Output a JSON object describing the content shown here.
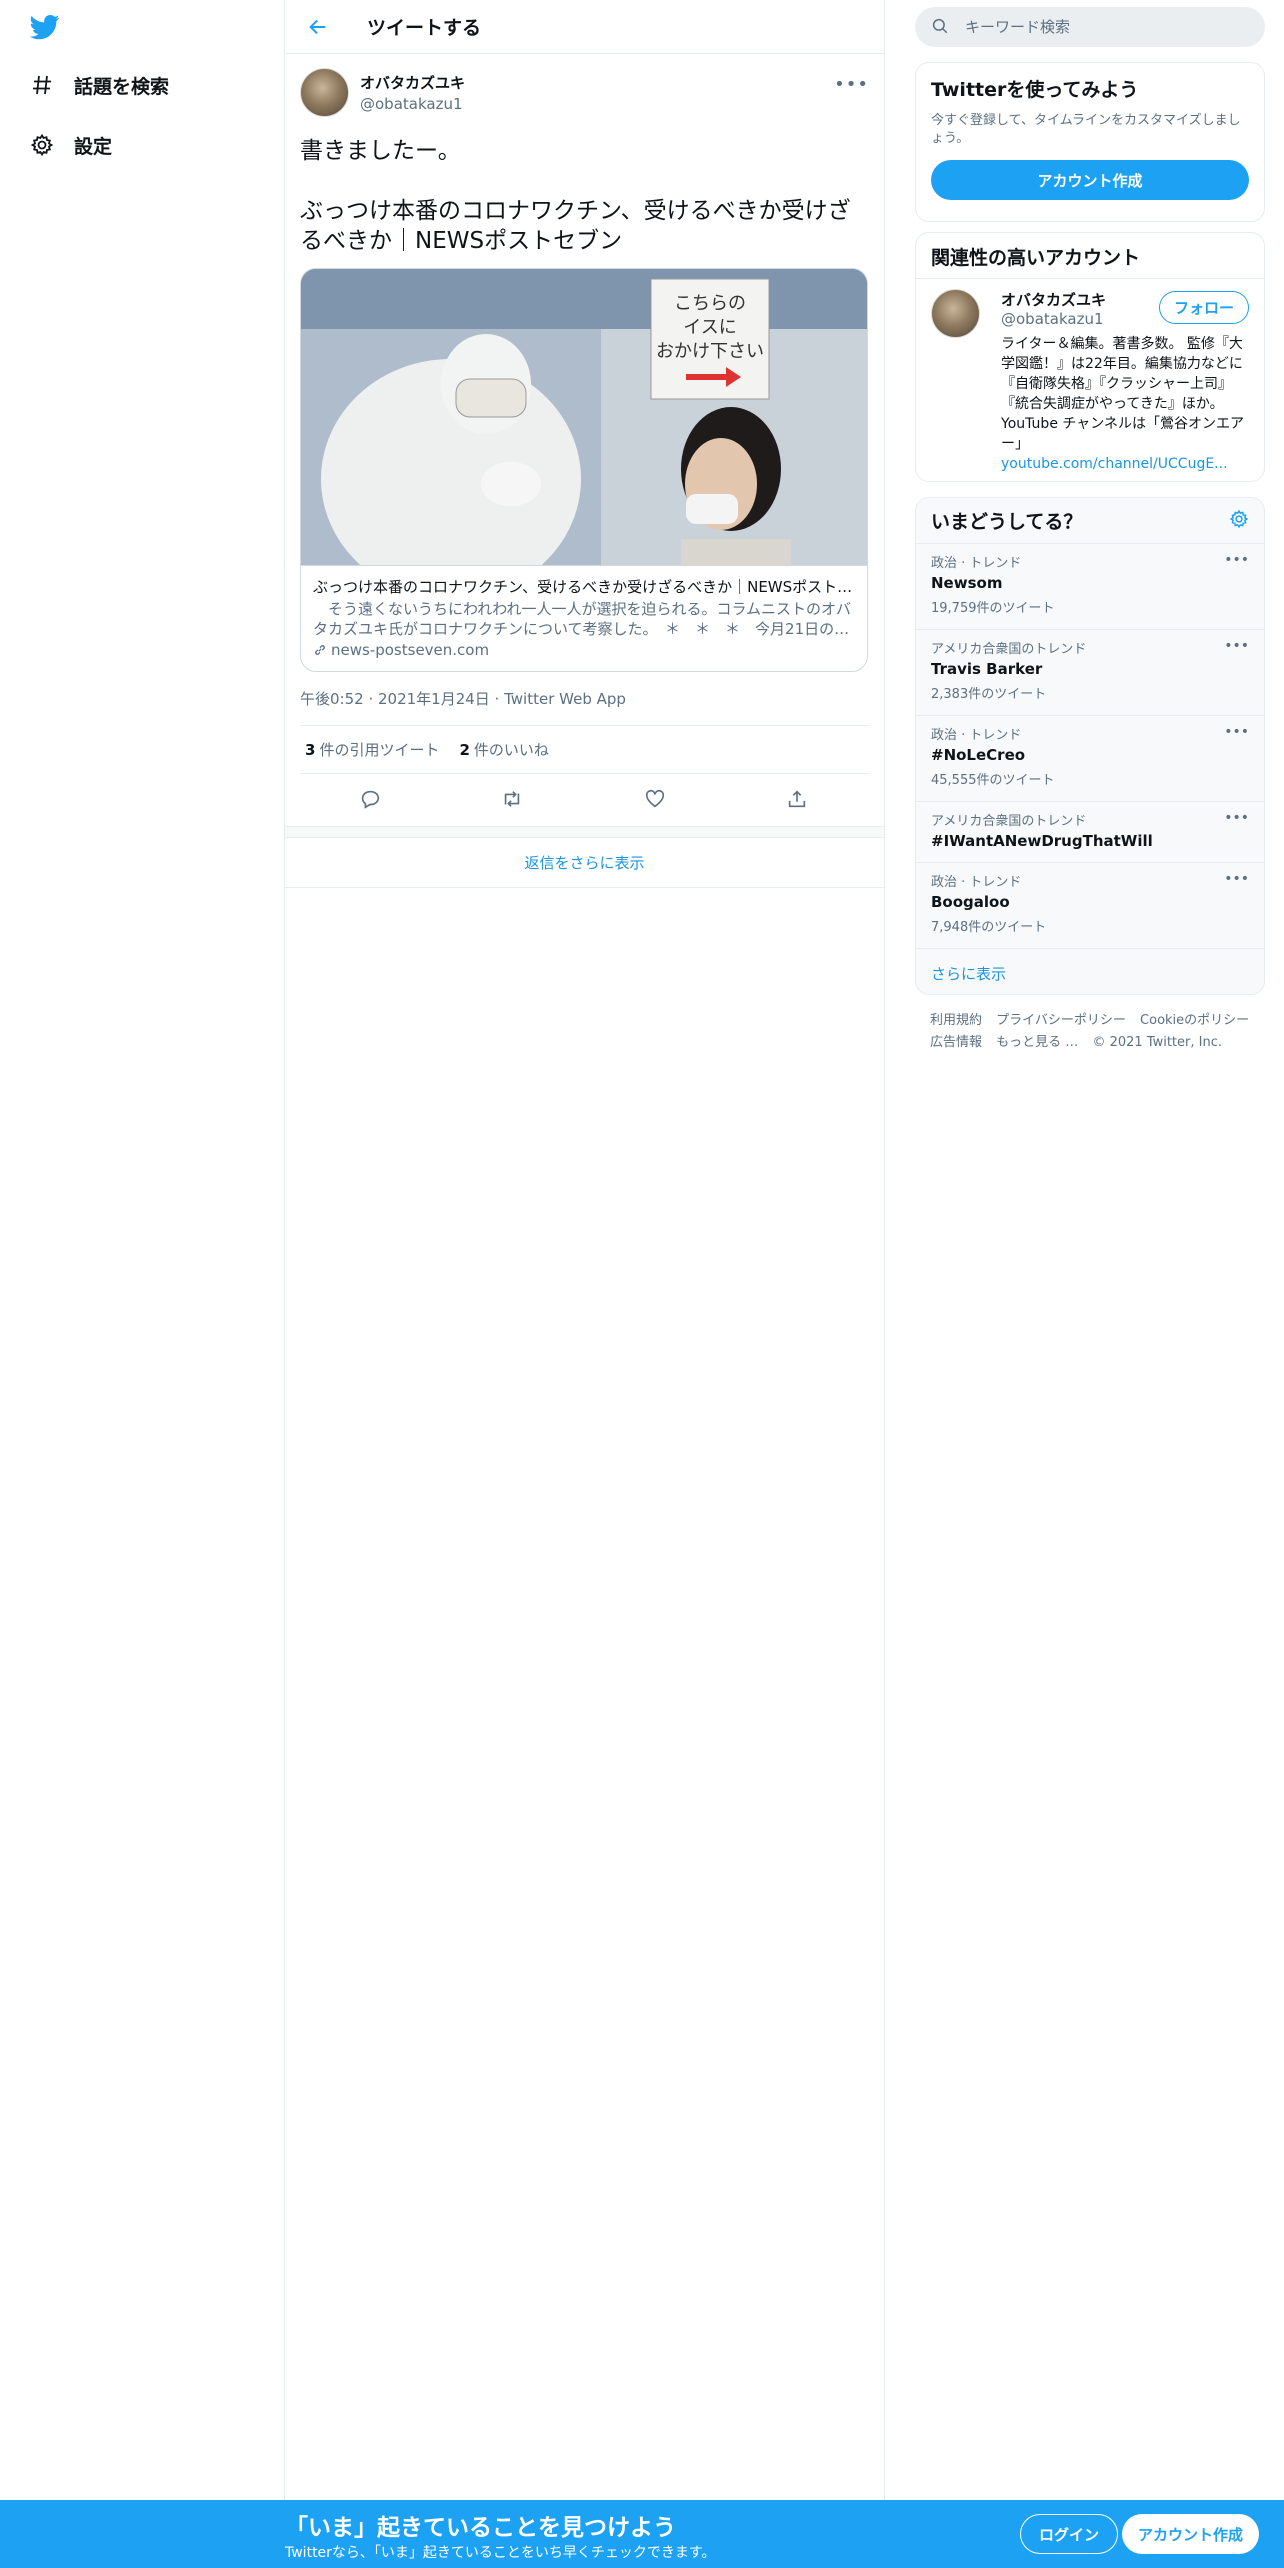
{
  "colors": {
    "brand": "#1da1f2",
    "link": "#1b95e0",
    "text": "#0f1419",
    "secondary": "#5b7083"
  },
  "nav": {
    "logo_icon": "twitter-bird-icon",
    "items": [
      {
        "label": "話題を検索",
        "icon": "hashtag-icon"
      },
      {
        "label": "設定",
        "icon": "gear-icon"
      }
    ]
  },
  "header": {
    "back_icon": "back-arrow-icon",
    "title": "ツイートする"
  },
  "tweet": {
    "author_name": "オバタカズユキ",
    "author_handle": "@obatakazu1",
    "more_icon": "more-dots-icon",
    "text": "書きましたー。\n\nぶっつけ本番のコロナワクチン、受けるべきか受けざるべきか｜NEWSポストセブン",
    "card": {
      "title": "ぶっつけ本番のコロナワクチン、受けるべきか受けざるべきか｜NEWSポストセブン",
      "description": "　そう遠くないうちにわれわれ一人一人が選択を迫られる。コラムニストのオバタカズユキ氏がコロナワクチンについて考察した。　＊　＊　＊　今月21日の…",
      "domain": "news-postseven.com",
      "image_sign": "こちらのイスにおかけ下さい"
    },
    "meta": "午後0:52 · 2021年1月24日 · Twitter Web App",
    "quote_count": "3",
    "quote_label": "件の引用ツイート",
    "like_count": "2",
    "like_label": "件のいいね",
    "actions": [
      "reply-icon",
      "retweet-icon",
      "like-icon",
      "share-icon"
    ]
  },
  "show_more_replies": "返信をさらに表示",
  "search": {
    "placeholder": "キーワード検索"
  },
  "signup_box": {
    "title": "Twitterを使ってみよう",
    "text": "今すぐ登録して、タイムラインをカスタマイズしましょう。",
    "button": "アカウント作成"
  },
  "related": {
    "title": "関連性の高いアカウント",
    "name": "オバタカズユキ",
    "handle": "@obatakazu1",
    "follow": "フォロー",
    "bio": "ライター＆編集。著書多数。 監修『大学図鑑！』は22年目。編集協力などに『自衛隊失格』『クラッシャー上司』『統合失調症がやってきた』ほか。YouTube チャンネルは「鶯谷オンエアー」",
    "bio_link": "youtube.com/channel/UCCugE..."
  },
  "trends": {
    "title": "いまどうしてる？",
    "settings_icon": "gear-icon",
    "items": [
      {
        "context": "政治 · トレンド",
        "name": "Newsom",
        "count": "19,759件のツイート"
      },
      {
        "context": "アメリカ合衆国のトレンド",
        "name": "Travis Barker",
        "count": "2,383件のツイート"
      },
      {
        "context": "政治 · トレンド",
        "name": "#NoLeCreo",
        "count": "45,555件のツイート"
      },
      {
        "context": "アメリカ合衆国のトレンド",
        "name": "#IWantANewDrugThatWill",
        "count": ""
      },
      {
        "context": "政治 · トレンド",
        "name": "Boogaloo",
        "count": "7,948件のツイート"
      }
    ],
    "show_more": "さらに表示"
  },
  "footer": {
    "links": [
      "利用規約",
      "プライバシーポリシー",
      "Cookieのポリシー",
      "広告情報",
      "もっと見る …"
    ],
    "copyright": "© 2021 Twitter, Inc."
  },
  "bottom_bar": {
    "title": "「いま」起きていることを見つけよう",
    "subtitle": "Twitterなら、「いま」起きていることをいち早くチェックできます。",
    "login": "ログイン",
    "signup": "アカウント作成"
  }
}
